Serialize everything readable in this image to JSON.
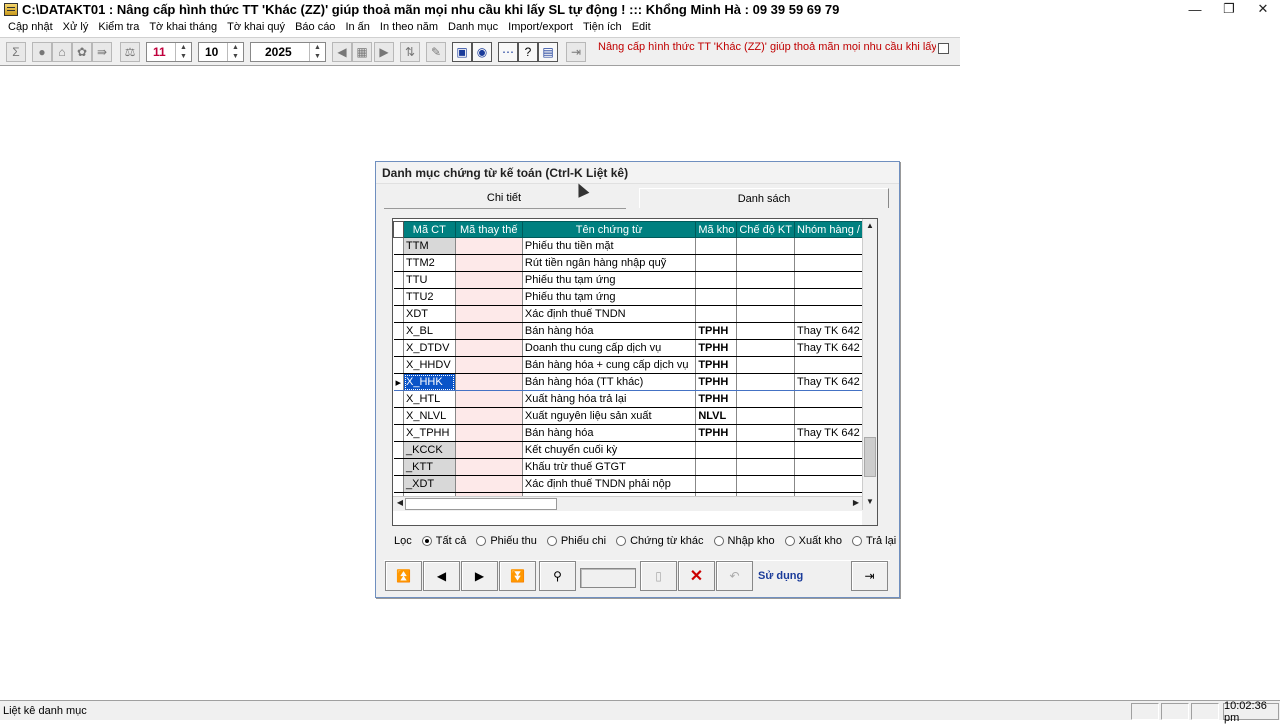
{
  "window": {
    "title": "C:\\DATAKT01 : Nâng cấp hình thức TT 'Khác (ZZ)' giúp thoả mãn mọi nhu cầu khi lấy SL tự động ! ::: Khổng Minh Hà : 09 39 59 69 79",
    "minimize_glyph": "—",
    "restore_glyph": "❐",
    "close_glyph": "✕"
  },
  "menu": [
    "Cập nhật",
    "Xử lý",
    "Kiểm tra",
    "Tờ khai tháng",
    "Tờ khai quý",
    "Báo cáo",
    "In ấn",
    "In theo năm",
    "Danh mục",
    "Import/export",
    "Tiện ích",
    "Edit"
  ],
  "toolbar": {
    "day": "11",
    "month": "10",
    "year": "2025",
    "notice": "Nâng cấp hình thức TT 'Khác (ZZ)' giúp thoả mãn mọi nhu cầu khi lấy SL tự"
  },
  "dialog": {
    "title": "Danh mục chứng từ kế toán (Ctrl-K Liệt kê)",
    "tabs": [
      "Chi tiết",
      "Danh sách"
    ],
    "columns": [
      "Mã CT",
      "Mã thay thế",
      "Tên chứng từ",
      "Mã kho",
      "Chế độ KT",
      "Nhóm hàng /"
    ],
    "rows": [
      {
        "code": "TTM",
        "alt": "",
        "name": "Phiếu thu tiền mặt",
        "kho": "",
        "cdkt": "",
        "nhom": ""
      },
      {
        "code": "TTM2",
        "alt": "",
        "name": "Rút tiền ngân hàng nhập quỹ",
        "kho": "",
        "cdkt": "",
        "nhom": ""
      },
      {
        "code": "TTU",
        "alt": "",
        "name": "Phiếu thu tạm ứng",
        "kho": "",
        "cdkt": "",
        "nhom": ""
      },
      {
        "code": "TTU2",
        "alt": "",
        "name": "Phiếu thu tạm ứng",
        "kho": "",
        "cdkt": "",
        "nhom": ""
      },
      {
        "code": "XDT",
        "alt": "",
        "name": "Xác định thuế TNDN",
        "kho": "",
        "cdkt": "",
        "nhom": ""
      },
      {
        "code": "X_BL",
        "alt": "",
        "name": "Bán hàng hóa",
        "kho": "TPHH",
        "cdkt": "",
        "nhom": "Thay TK 642"
      },
      {
        "code": "X_DTDV",
        "alt": "",
        "name": "Doanh thu cung cấp dịch vụ",
        "kho": "TPHH",
        "cdkt": "",
        "nhom": "Thay TK 642"
      },
      {
        "code": "X_HHDV",
        "alt": "",
        "name": "Bán hàng hóa + cung cấp dịch vụ",
        "kho": "TPHH",
        "cdkt": "",
        "nhom": ""
      },
      {
        "code": "X_HHK",
        "alt": "",
        "name": "Bán hàng hóa (TT khác)",
        "kho": "TPHH",
        "cdkt": "",
        "nhom": "Thay TK 642"
      },
      {
        "code": "X_HTL",
        "alt": "",
        "name": "Xuất hàng hóa trả lại",
        "kho": "TPHH",
        "cdkt": "",
        "nhom": ""
      },
      {
        "code": "X_NLVL",
        "alt": "",
        "name": "Xuất nguyên liệu sản xuất",
        "kho": "NLVL",
        "cdkt": "",
        "nhom": ""
      },
      {
        "code": "X_TPHH",
        "alt": "",
        "name": "Bán hàng hóa",
        "kho": "TPHH",
        "cdkt": "",
        "nhom": "Thay TK 642"
      },
      {
        "code": "_KCCK",
        "alt": "",
        "name": "Kết chuyển cuối kỳ",
        "kho": "",
        "cdkt": "",
        "nhom": ""
      },
      {
        "code": "_KTT",
        "alt": "",
        "name": "Khấu trừ thuế GTGT",
        "kho": "",
        "cdkt": "",
        "nhom": ""
      },
      {
        "code": "_XDT",
        "alt": "",
        "name": "Xác định thuế TNDN phải nộp",
        "kho": "",
        "cdkt": "",
        "nhom": ""
      },
      {
        "code": "",
        "alt": "",
        "name": "",
        "kho": "",
        "cdkt": "",
        "nhom": ""
      }
    ],
    "selected_code": "X_HHK",
    "filter_label": "Lọc",
    "filters": [
      "Tất cả",
      "Phiếu thu",
      "Phiếu chi",
      "Chứng từ khác",
      "Nhập kho",
      "Xuất kho",
      "Trả lại"
    ],
    "filter_selected": "Tất cả",
    "use_label": "Sử dụng"
  },
  "status": {
    "text": "Liệt kê danh mục",
    "time": "10:02:36 pm"
  }
}
